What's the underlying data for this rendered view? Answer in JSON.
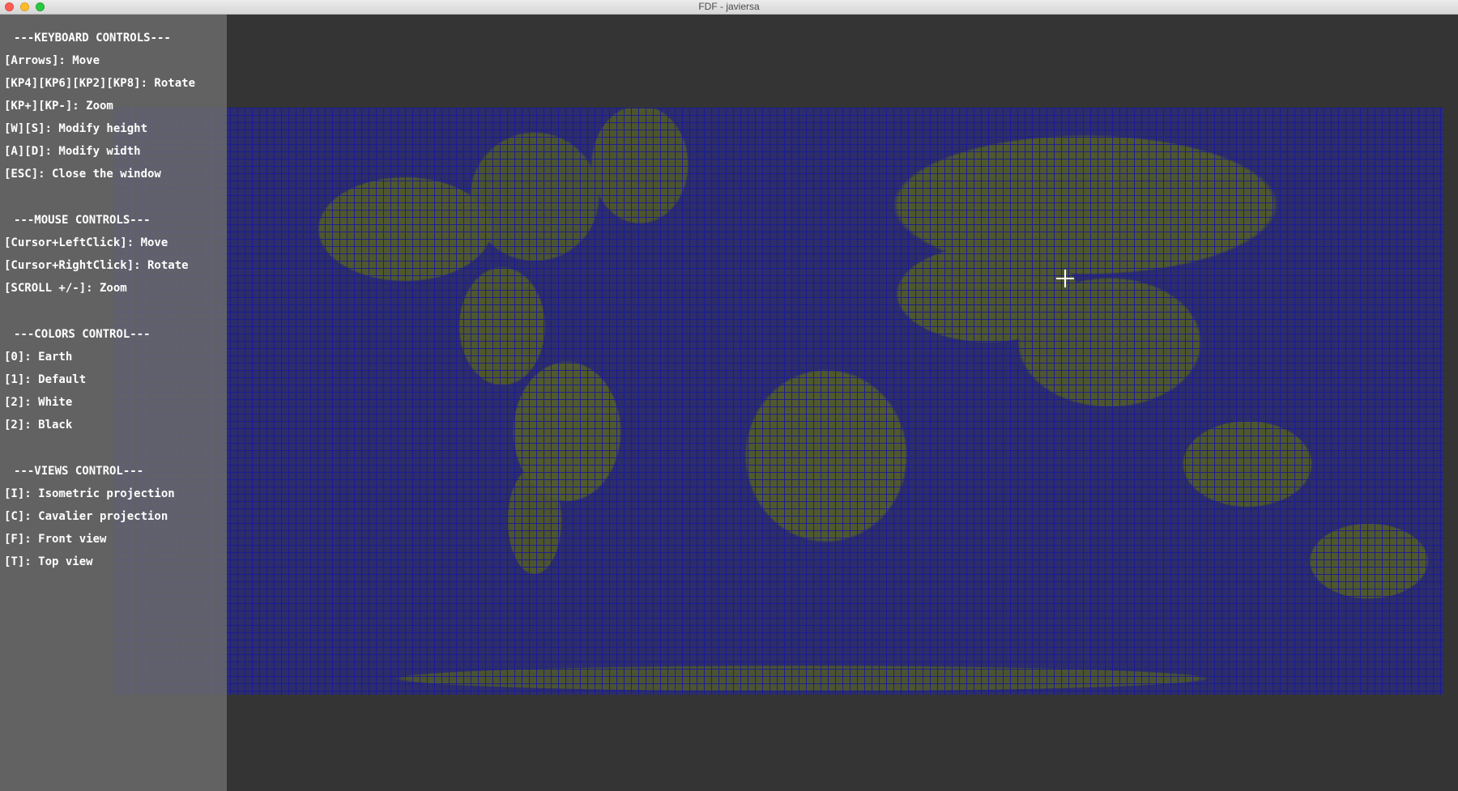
{
  "window": {
    "title": "FDF - javiersa"
  },
  "panel": {
    "keyboard": {
      "heading": "---KEYBOARD CONTROLS---",
      "items": [
        "[Arrows]: Move",
        "[KP4][KP6][KP2][KP8]: Rotate",
        "[KP+][KP-]: Zoom",
        "[W][S]: Modify height",
        "[A][D]: Modify width",
        "[ESC]: Close the window"
      ]
    },
    "mouse": {
      "heading": "---MOUSE CONTROLS---",
      "items": [
        "[Cursor+LeftClick]: Move",
        "[Cursor+RightClick]: Rotate",
        "[SCROLL +/-]: Zoom"
      ]
    },
    "colors": {
      "heading": "---COLORS CONTROL---",
      "items": [
        "[0]: Earth",
        "[1]: Default",
        "[2]: White",
        "[2]: Black"
      ]
    },
    "views": {
      "heading": "---VIEWS CONTROL---",
      "items": [
        "[I]: Isometric projection",
        "[C]: Cavalier projection",
        "[F]: Front view",
        "[T]: Top view"
      ]
    }
  },
  "icons": {
    "close": "close-icon",
    "minimize": "minimize-icon",
    "zoom": "zoom-icon",
    "cursor": "crosshair-cursor-icon"
  },
  "colors": {
    "canvas_background": "#343434",
    "panel_background": "#6c6c6c",
    "wire_water": "#1a1a96",
    "wire_land": "#4f582c",
    "panel_text": "#ffffff"
  }
}
